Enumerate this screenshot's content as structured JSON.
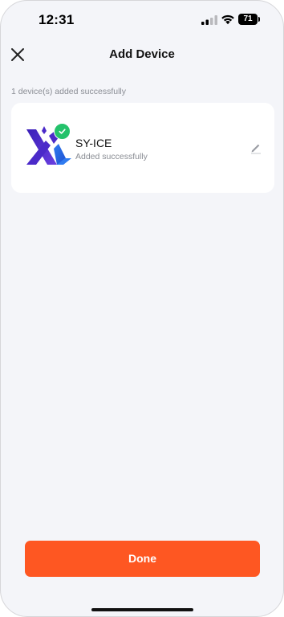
{
  "status_bar": {
    "time": "12:31",
    "battery_level": "71",
    "icons": [
      "signal-icon",
      "wifi-icon",
      "battery-icon"
    ]
  },
  "header": {
    "title": "Add Device",
    "close_icon": "close-icon"
  },
  "summary": {
    "text": "1 device(s) added successfully"
  },
  "devices": [
    {
      "name": "SY-ICE",
      "status": "Added successfully",
      "logo_icon": "sy-ice-logo-icon",
      "badge_icon": "check-badge-icon",
      "edit_icon": "edit-pencil-icon"
    }
  ],
  "footer": {
    "done_label": "Done"
  },
  "colors": {
    "background": "#f4f5f9",
    "card": "#ffffff",
    "accent": "#fe5722",
    "success": "#24c26b",
    "logo_purple": "#4b2ac9",
    "logo_blue": "#2f7bf0"
  }
}
